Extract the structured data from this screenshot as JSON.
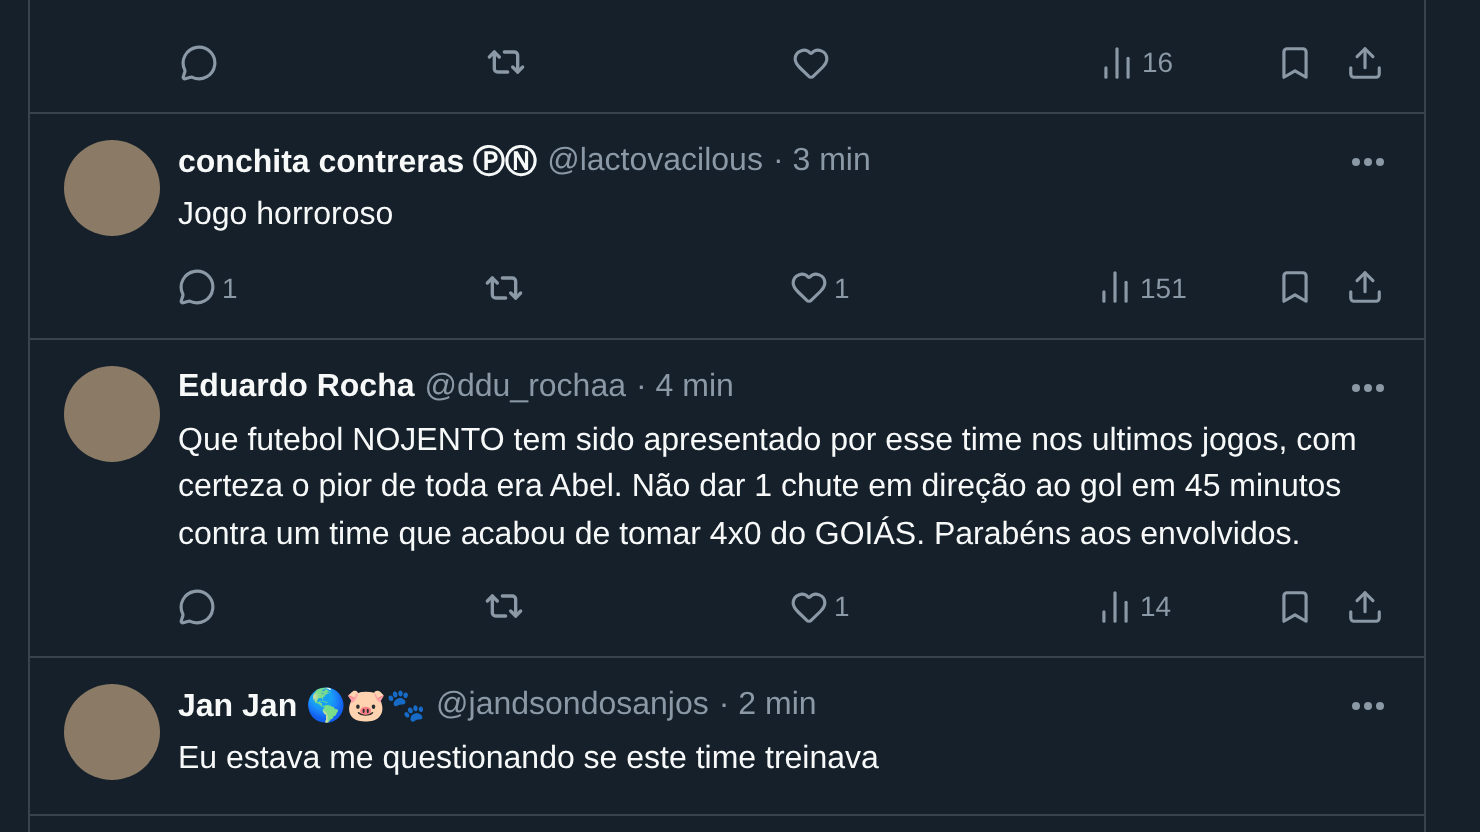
{
  "top_tweet": {
    "actions": {
      "views": "16"
    }
  },
  "tweets": [
    {
      "name": "conchita contreras ⓅⓃ",
      "handle": "@lactovacilous",
      "time": "· 3 min",
      "text": "Jogo horroroso",
      "actions": {
        "reply_count": "1",
        "like_count": "1",
        "views": "151"
      }
    },
    {
      "name": "Eduardo Rocha",
      "handle": "@ddu_rochaa",
      "time": "· 4 min",
      "text": "Que futebol NOJENTO tem sido apresentado por esse time nos ultimos jogos, com certeza o pior de toda era Abel. Não dar 1 chute em direção ao gol em 45 minutos contra um time que acabou de tomar 4x0 do GOIÁS. Parabéns aos envolvidos.",
      "actions": {
        "like_count": "1",
        "views": "14"
      }
    },
    {
      "name": "Jan Jan 🌎🐷🐾",
      "handle": "@jandsondosanjos",
      "time": "· 2 min",
      "text": "Eu estava me questionando se este time treinava"
    }
  ]
}
